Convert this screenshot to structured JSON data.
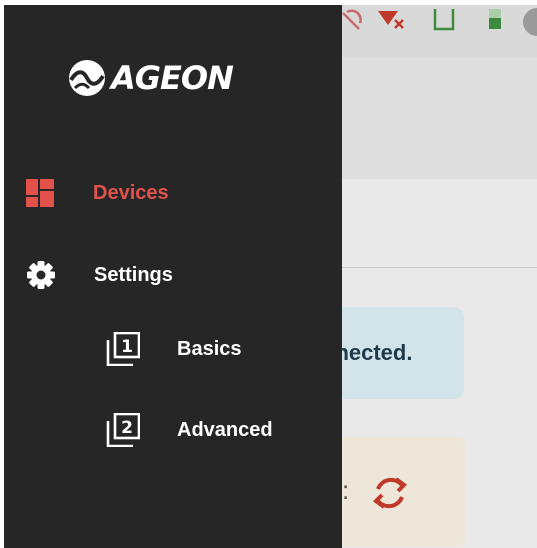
{
  "brand": {
    "name": "AGEON"
  },
  "nav": {
    "devices": {
      "label": "Devices",
      "icon": "dashboard-icon",
      "active": true
    },
    "settings": {
      "label": "Settings",
      "icon": "gear-icon"
    },
    "basics": {
      "label": "Basics",
      "icon": "filter-1-icon"
    },
    "advanced": {
      "label": "Advanced",
      "icon": "filter-2-icon"
    }
  },
  "background": {
    "connected_text": "nnected.",
    "colon": ":"
  },
  "colors": {
    "drawer_bg": "#262626",
    "active": "#e2514a",
    "text": "#ffffff",
    "sync_icon": "#c0392b"
  }
}
